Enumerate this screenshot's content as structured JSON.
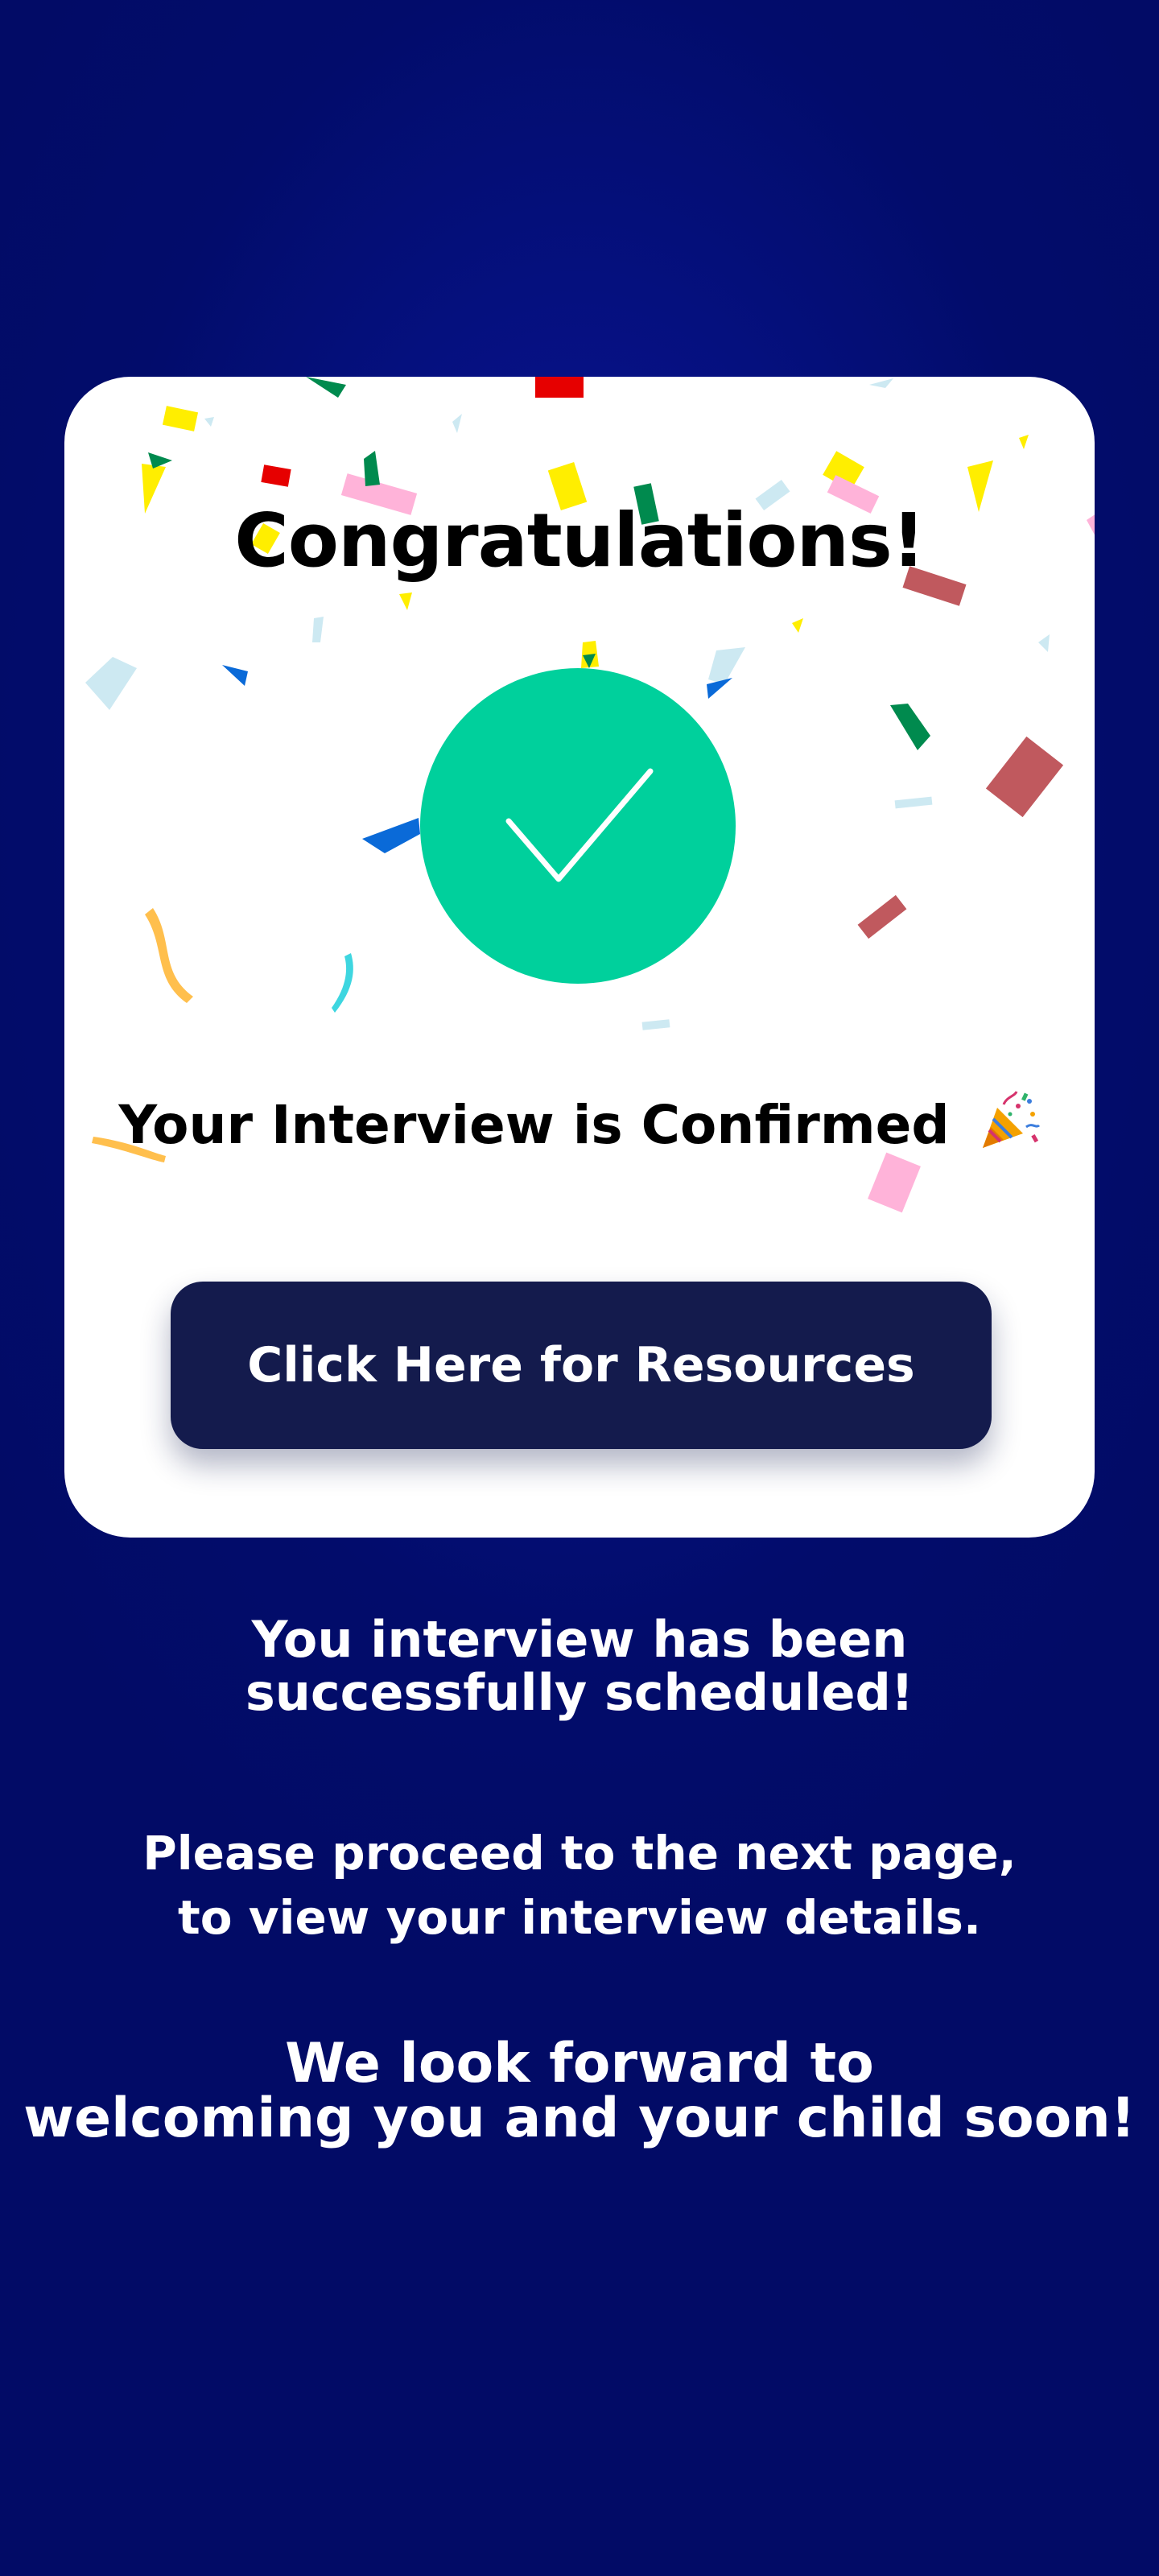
{
  "card": {
    "title": "Congratulations!",
    "status_icon": "checkmark-circle-icon",
    "confirmation_text": "Your Interview is Confirmed",
    "celebration_icon": "party-popper-icon",
    "button_label": "Click Here for Resources"
  },
  "messages": {
    "scheduled_line1": "You interview has been",
    "scheduled_line2": "successfully scheduled!",
    "proceed_line1": "Please proceed to the next page,",
    "proceed_line2": "to view your interview details.",
    "welcome_line1": "We look forward to",
    "welcome_line2": "welcoming you and your child soon!"
  },
  "colors": {
    "background": "#020c6b",
    "card": "#ffffff",
    "success_green": "#00d09c",
    "button": "#141b4d",
    "text_dark": "#000000",
    "text_light": "#ffffff"
  },
  "decorations": {
    "confetti_colors": [
      "#ffee00",
      "#e60000",
      "#ffb3d9",
      "#008a4e",
      "#c0595e",
      "#cde9f2",
      "#0a6ad8",
      "#ffbf4d",
      "#3ed6e0"
    ]
  }
}
